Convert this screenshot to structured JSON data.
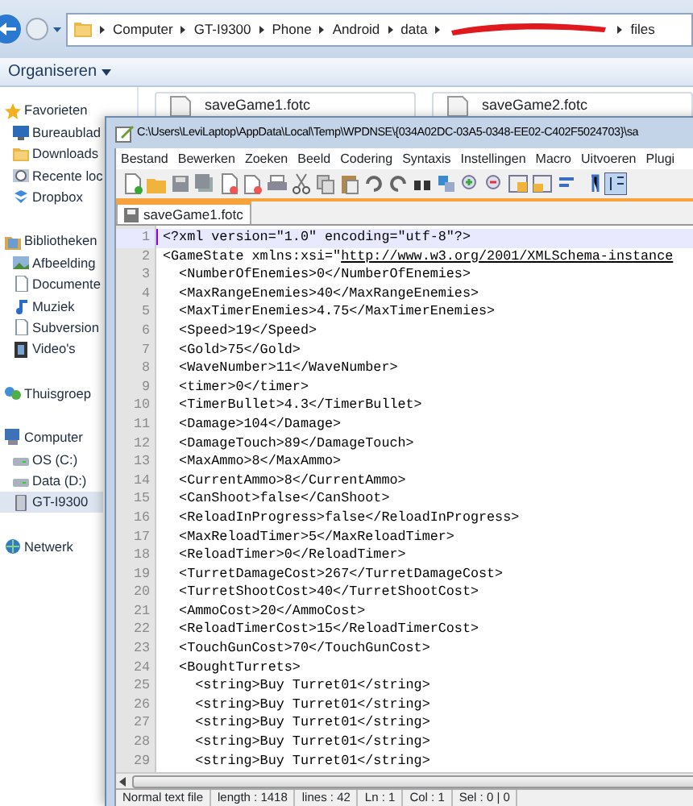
{
  "explorer": {
    "breadcrumb": [
      "Computer",
      "GT-I9300",
      "Phone",
      "Android",
      "data",
      "files"
    ],
    "toolbar": {
      "organize": "Organiseren"
    },
    "files": [
      "saveGame1.fotc",
      "saveGame2.fotc"
    ],
    "sidebar": [
      {
        "label": "Favorieten",
        "items": [
          {
            "label": "Bureaublad",
            "selected": false
          },
          {
            "label": "Downloads",
            "selected": false
          },
          {
            "label": "Recente loc",
            "selected": false
          },
          {
            "label": "Dropbox",
            "selected": false
          }
        ]
      },
      {
        "label": "Bibliotheken",
        "items": [
          {
            "label": "Afbeelding",
            "selected": false
          },
          {
            "label": "Documente",
            "selected": false
          },
          {
            "label": "Muziek",
            "selected": false
          },
          {
            "label": "Subversion",
            "selected": false
          },
          {
            "label": "Video's",
            "selected": false
          }
        ]
      },
      {
        "label": "Thuisgroep"
      },
      {
        "label": "Computer",
        "items": [
          {
            "label": "OS (C:)",
            "selected": false
          },
          {
            "label": "Data (D:)",
            "selected": false
          },
          {
            "label": "GT-I9300",
            "selected": true
          }
        ]
      },
      {
        "label": "Netwerk"
      }
    ]
  },
  "editor": {
    "title": "C:\\Users\\LeviLaptop\\AppData\\Local\\Temp\\WPDNSE\\{034A02DC-03A5-0348-EE02-C402F5024703}\\sa",
    "menu": [
      "Bestand",
      "Bewerken",
      "Zoeken",
      "Beeld",
      "Codering",
      "Syntaxis",
      "Instellingen",
      "Macro",
      "Uitvoeren",
      "Plugi"
    ],
    "tab": {
      "label": "saveGame1.fotc",
      "selected": true
    },
    "lines": [
      {
        "number": "1",
        "text": "<?xml version=\"1.0\" encoding=\"utf-8\"?>",
        "current": true
      },
      {
        "number": "2",
        "text": "<GameState xmlns:xsi=\"",
        "link": "http://www.w3.org/2001/XMLSchema-instance",
        "current": false
      },
      {
        "number": "3",
        "text": "  <NumberOfEnemies>0</NumberOfEnemies>",
        "current": false
      },
      {
        "number": "4",
        "text": "  <MaxRangeEnemies>40</MaxRangeEnemies>",
        "current": false
      },
      {
        "number": "5",
        "text": "  <MaxTimerEnemies>4.75</MaxTimerEnemies>",
        "current": false
      },
      {
        "number": "6",
        "text": "  <Speed>19</Speed>",
        "current": false
      },
      {
        "number": "7",
        "text": "  <Gold>75</Gold>",
        "current": false
      },
      {
        "number": "8",
        "text": "  <WaveNumber>11</WaveNumber>",
        "current": false
      },
      {
        "number": "9",
        "text": "  <timer>0</timer>",
        "current": false
      },
      {
        "number": "10",
        "text": "  <TimerBullet>4.3</TimerBullet>",
        "current": false
      },
      {
        "number": "11",
        "text": "  <Damage>104</Damage>",
        "current": false
      },
      {
        "number": "12",
        "text": "  <DamageTouch>89</DamageTouch>",
        "current": false
      },
      {
        "number": "13",
        "text": "  <MaxAmmo>8</MaxAmmo>",
        "current": false
      },
      {
        "number": "14",
        "text": "  <CurrentAmmo>8</CurrentAmmo>",
        "current": false
      },
      {
        "number": "15",
        "text": "  <CanShoot>false</CanShoot>",
        "current": false
      },
      {
        "number": "16",
        "text": "  <ReloadInProgress>false</ReloadInProgress>",
        "current": false
      },
      {
        "number": "17",
        "text": "  <MaxReloadTimer>5</MaxReloadTimer>",
        "current": false
      },
      {
        "number": "18",
        "text": "  <ReloadTimer>0</ReloadTimer>",
        "current": false
      },
      {
        "number": "19",
        "text": "  <TurretDamageCost>267</TurretDamageCost>",
        "current": false
      },
      {
        "number": "20",
        "text": "  <TurretShootCost>40</TurretShootCost>",
        "current": false
      },
      {
        "number": "21",
        "text": "  <AmmoCost>20</AmmoCost>",
        "current": false
      },
      {
        "number": "22",
        "text": "  <ReloadTimerCost>15</ReloadTimerCost>",
        "current": false
      },
      {
        "number": "23",
        "text": "  <TouchGunCost>70</TouchGunCost>",
        "current": false
      },
      {
        "number": "24",
        "text": "  <BoughtTurrets>",
        "current": false
      },
      {
        "number": "25",
        "text": "    <string>Buy Turret01</string>",
        "current": false
      },
      {
        "number": "26",
        "text": "    <string>Buy Turret01</string>",
        "current": false
      },
      {
        "number": "27",
        "text": "    <string>Buy Turret01</string>",
        "current": false
      },
      {
        "number": "28",
        "text": "    <string>Buy Turret01</string>",
        "current": false
      },
      {
        "number": "29",
        "text": "    <string>Buy Turret01</string>",
        "current": false
      }
    ],
    "status": [
      "Normal text file",
      "length : 1418",
      "lines : 42",
      "Ln : 1",
      "Col : 1",
      "Sel : 0 | 0"
    ]
  }
}
